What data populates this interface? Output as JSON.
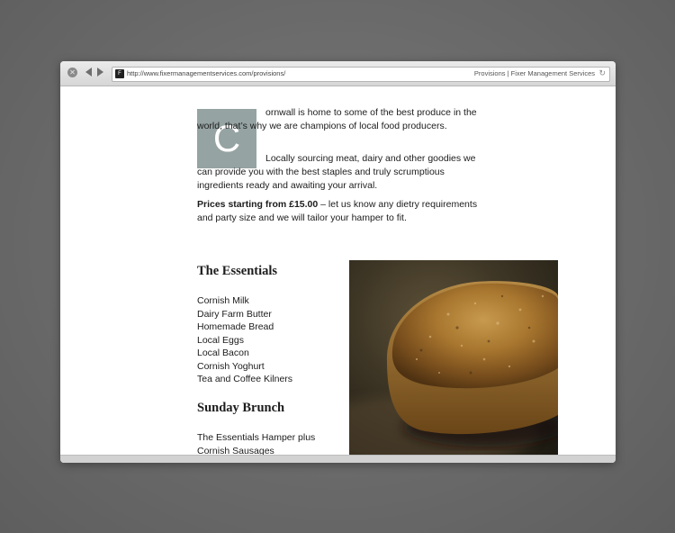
{
  "browser": {
    "url": "http://www.fixermanagementservices.com/provisions/",
    "tab_title": "Provisions | Fixer Management Services",
    "favicon_letter": "F",
    "icons": {
      "close": "close-icon",
      "back": "back-arrow-icon",
      "forward": "forward-arrow-icon",
      "reload": "reload-icon"
    }
  },
  "intro": {
    "dropcap": "C",
    "p1": "ornwall is home to some of the best produce in the world, that’s why we are champions of local food producers.",
    "p2": "Locally sourcing meat, dairy and other goodies we can provide you with the best staples and truly scrumptious ingredients ready and awaiting your arrival.",
    "price_bold": "Prices starting from £15.00",
    "price_rest": " – let us know any dietry requirements and party size and we will tailor your hamper to fit."
  },
  "hampers": [
    {
      "title": "The Essentials",
      "items": [
        "Cornish Milk",
        "Dairy Farm Butter",
        "Homemade Bread",
        "Local Eggs",
        "Local Bacon",
        "Cornish Yoghurt",
        "Tea and Coffee Kilners"
      ]
    },
    {
      "title": "Sunday Brunch",
      "items": [
        "The Essentials Hamper plus",
        "Cornish Sausages"
      ]
    }
  ],
  "colors": {
    "dropcap_bg": "#95a3a2",
    "background": "#6d6d6d"
  }
}
